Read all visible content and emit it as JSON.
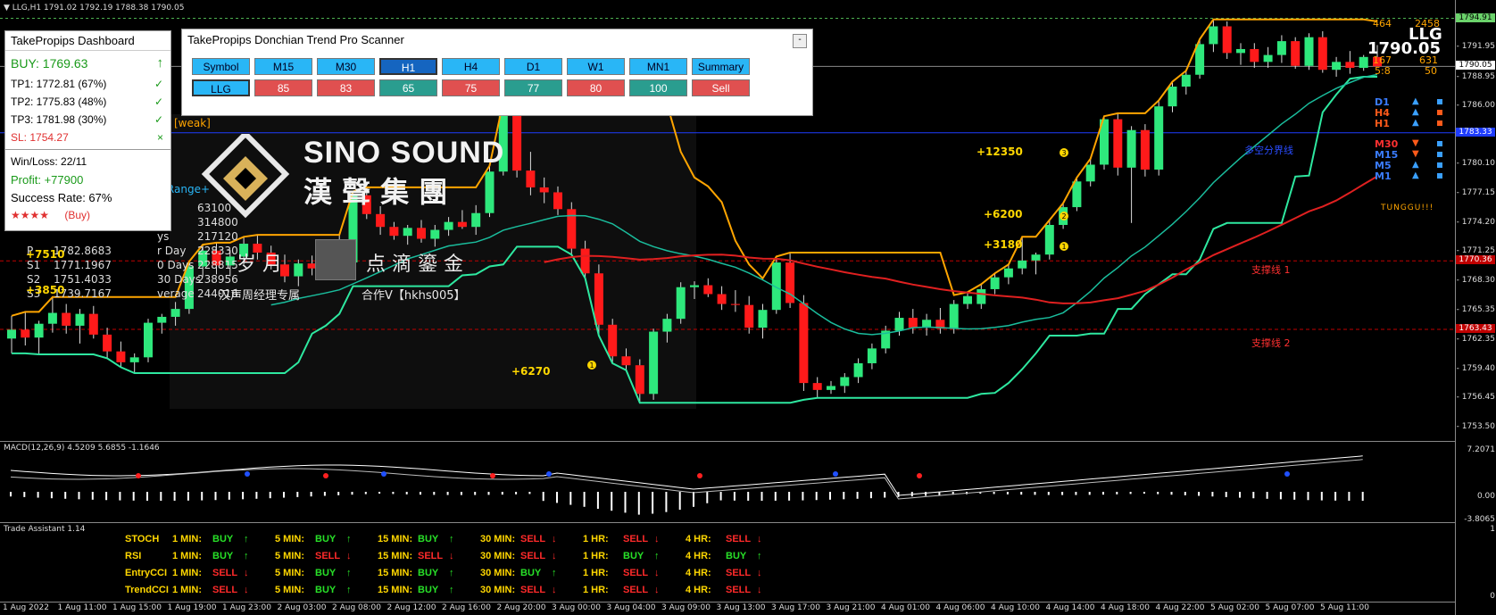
{
  "window": {
    "title": "▼ LLG,H1  1791.02 1792.19 1788.38 1790.05"
  },
  "watermark": {
    "brand": "SINO SOUND",
    "brand_cn": "漢 聲 集 團",
    "slogan_left": "岁 月",
    "slogan_right": "点 滴 鎏 金",
    "caption_left": "汉声周经理专属",
    "caption_right": "合作V【hkhs005】"
  },
  "dashboard": {
    "title": "TakePropips Dashboard",
    "signal": "BUY: 1769.63",
    "tp1": "TP1: 1772.81 (67%)",
    "tp2": "TP2: 1775.83 (48%)",
    "tp3": "TP3: 1781.98 (30%)",
    "sl_label": "SL:",
    "sl_value": "1754.27",
    "winloss": "Win/Loss: 22/11",
    "profit": "Profit: +77900",
    "success": "Success Rate: 67%",
    "stars": "★★★★",
    "stars_label": "(Buy)",
    "check": "✓",
    "cross": "×",
    "arrow_up": "↑"
  },
  "scanner": {
    "title": "TakePropips Donchian Trend Pro Scanner",
    "minimize": "-",
    "headers": [
      "Symbol",
      "M15",
      "M30",
      "H1",
      "H4",
      "D1",
      "W1",
      "MN1",
      "Summary"
    ],
    "values": [
      "LLG",
      "85",
      "83",
      "65",
      "75",
      "77",
      "80",
      "100",
      "Sell"
    ],
    "value_colors": [
      "hdr",
      "red",
      "red",
      "teal",
      "red",
      "teal",
      "red",
      "teal",
      "red"
    ]
  },
  "chart_labels": {
    "weak": "[weak]",
    "range": "y Range+",
    "hidden_rows": [
      {
        "k": "y",
        "v": "63100"
      },
      {
        "k": "ys",
        "v": "314800"
      },
      {
        "k": "ys",
        "v": "217120"
      },
      {
        "k": "r Day",
        "v": "228330"
      },
      {
        "k": "0 Days",
        "v": "228815"
      },
      {
        "k": "30 Days",
        "v": "238956"
      },
      {
        "k": "verage",
        "v": "244016"
      }
    ],
    "pivots": [
      {
        "k": "P",
        "v": "1782.8683"
      },
      {
        "k": "S1",
        "v": "1771.1967"
      },
      {
        "k": "S2",
        "v": "1751.4033"
      },
      {
        "k": "S3",
        "v": "1739.7167"
      }
    ],
    "plus_7510": "+7510",
    "plus_3850": "+3850",
    "plus_6270": "+6270",
    "plus_12350": "+12350",
    "plus_6200": "+6200",
    "plus_3180": "+3180",
    "n1": "1",
    "n2": "2",
    "n3": "3",
    "support_line": "支撑线 1",
    "support_line2": "支撑线 2",
    "divider_line": "多空分界线",
    "symbol_big": "LLG",
    "price_big": "1790.05",
    "top_nums": [
      "464",
      "2458"
    ],
    "mid_nums": [
      "167",
      "631"
    ],
    "ratio": [
      "5:8",
      "50"
    ],
    "brand_small": "TUNGGU!!!"
  },
  "timeframes": [
    {
      "label": "D1",
      "color": "#3a7cff",
      "arrow": "▲",
      "arrow_color": "#3aa0ff",
      "sq": "#3aa0ff"
    },
    {
      "label": "H4",
      "color": "#ff5a1a",
      "arrow": "▲",
      "arrow_color": "#3aa0ff",
      "sq": "#ff5a1a"
    },
    {
      "label": "H1",
      "color": "#ff5a1a",
      "arrow": "▲",
      "arrow_color": "#3aa0ff",
      "sq": "#ff5a1a"
    },
    {
      "label": "M30",
      "color": "#ff3030",
      "arrow": "▼",
      "arrow_color": "#ff5a1a",
      "sq": "#3aa0ff"
    },
    {
      "label": "M15",
      "color": "#3a7cff",
      "arrow": "▼",
      "arrow_color": "#ff5a1a",
      "sq": "#3aa0ff"
    },
    {
      "label": "M5",
      "color": "#3a7cff",
      "arrow": "▲",
      "arrow_color": "#3aa0ff",
      "sq": "#3aa0ff"
    },
    {
      "label": "M1",
      "color": "#3a7cff",
      "arrow": "▲",
      "arrow_color": "#3aa0ff",
      "sq": "#3aa0ff"
    }
  ],
  "price_scale": {
    "labels": [
      "1794.91",
      "1791.95",
      "1790.05",
      "1788.95",
      "1786.00",
      "1783.05",
      "1780.10",
      "1777.15",
      "1774.20",
      "1771.25",
      "1768.30",
      "1765.35",
      "1762.35",
      "1759.40",
      "1756.45",
      "1753.50"
    ],
    "boxes": [
      {
        "text": "1794.91",
        "bg": "#6bd36b",
        "fg": "#000"
      },
      {
        "text": "1790.05",
        "bg": "#ffffff",
        "fg": "#000"
      },
      {
        "text": "1783.33",
        "bg": "#1e3cff",
        "fg": "#fff"
      },
      {
        "text": "1770.36",
        "bg": "#c00000",
        "fg": "#fff"
      },
      {
        "text": "1763.43",
        "bg": "#c00000",
        "fg": "#fff"
      }
    ],
    "macd_labels": [
      "7.2071",
      "0.00",
      "-3.8065"
    ],
    "ta_labels": [
      "1",
      "0"
    ]
  },
  "macd": {
    "title": "MACD(12,26,9) 4.5209 5.6855 -1.1646"
  },
  "trade_assistant": {
    "title": "Trade Assistant 1.14",
    "rows": [
      {
        "name": "STOCH",
        "cells": [
          [
            "1 MIN:",
            "BUY"
          ],
          [
            "5 MIN:",
            "BUY"
          ],
          [
            "15 MIN:",
            "BUY"
          ],
          [
            "30 MIN:",
            "SELL"
          ],
          [
            "1 HR:",
            "SELL"
          ],
          [
            "4 HR:",
            "SELL"
          ]
        ]
      },
      {
        "name": "RSI",
        "cells": [
          [
            "1 MIN:",
            "BUY"
          ],
          [
            "5 MIN:",
            "SELL"
          ],
          [
            "15 MIN:",
            "SELL"
          ],
          [
            "30 MIN:",
            "SELL"
          ],
          [
            "1 HR:",
            "BUY"
          ],
          [
            "4 HR:",
            "BUY"
          ]
        ]
      },
      {
        "name": "EntryCCI",
        "cells": [
          [
            "1 MIN:",
            "SELL"
          ],
          [
            "5 MIN:",
            "BUY"
          ],
          [
            "15 MIN:",
            "BUY"
          ],
          [
            "30 MIN:",
            "BUY"
          ],
          [
            "1 HR:",
            "SELL"
          ],
          [
            "4 HR:",
            "SELL"
          ]
        ]
      },
      {
        "name": "TrendCCI",
        "cells": [
          [
            "1 MIN:",
            "SELL"
          ],
          [
            "5 MIN:",
            "BUY"
          ],
          [
            "15 MIN:",
            "BUY"
          ],
          [
            "30 MIN:",
            "SELL"
          ],
          [
            "1 HR:",
            "SELL"
          ],
          [
            "4 HR:",
            "SELL"
          ]
        ]
      }
    ]
  },
  "time_axis": [
    "1 Aug 2022",
    "1 Aug 11:00",
    "1 Aug 15:00",
    "1 Aug 19:00",
    "1 Aug 23:00",
    "2 Aug 03:00",
    "2 Aug 08:00",
    "2 Aug 12:00",
    "2 Aug 16:00",
    "2 Aug 20:00",
    "3 Aug 00:00",
    "3 Aug 04:00",
    "3 Aug 09:00",
    "3 Aug 13:00",
    "3 Aug 17:00",
    "3 Aug 21:00",
    "4 Aug 01:00",
    "4 Aug 06:00",
    "4 Aug 10:00",
    "4 Aug 14:00",
    "4 Aug 18:00",
    "4 Aug 22:00",
    "5 Aug 02:00",
    "5 Aug 07:00",
    "5 Aug 11:00"
  ],
  "candles": [
    [
      1762.5,
      1764.8,
      1761.0,
      1763.4
    ],
    [
      1763.4,
      1765.2,
      1761.8,
      1762.6
    ],
    [
      1762.6,
      1764.3,
      1760.9,
      1764.0
    ],
    [
      1764.0,
      1766.7,
      1763.1,
      1765.1
    ],
    [
      1765.1,
      1766.0,
      1763.0,
      1763.8
    ],
    [
      1763.8,
      1765.5,
      1762.0,
      1765.0
    ],
    [
      1765.0,
      1765.8,
      1762.5,
      1762.9
    ],
    [
      1762.9,
      1763.6,
      1760.5,
      1761.2
    ],
    [
      1761.2,
      1762.2,
      1759.6,
      1760.1
    ],
    [
      1760.1,
      1761.0,
      1759.0,
      1760.6
    ],
    [
      1760.6,
      1764.5,
      1760.1,
      1764.1
    ],
    [
      1764.1,
      1765.0,
      1763.0,
      1764.7
    ],
    [
      1764.7,
      1766.2,
      1763.8,
      1765.5
    ],
    [
      1765.5,
      1770.3,
      1765.0,
      1769.8
    ],
    [
      1769.8,
      1772.0,
      1768.8,
      1771.4
    ],
    [
      1771.4,
      1772.2,
      1769.0,
      1769.9
    ],
    [
      1769.9,
      1771.5,
      1768.8,
      1770.8
    ],
    [
      1770.8,
      1772.8,
      1770.0,
      1772.1
    ],
    [
      1772.1,
      1773.0,
      1770.5,
      1771.2
    ],
    [
      1771.2,
      1771.9,
      1769.5,
      1770.0
    ],
    [
      1770.0,
      1771.0,
      1768.2,
      1768.8
    ],
    [
      1768.8,
      1770.5,
      1767.8,
      1770.1
    ],
    [
      1770.1,
      1770.9,
      1768.9,
      1769.6
    ],
    [
      1769.6,
      1771.3,
      1769.0,
      1770.7
    ],
    [
      1770.7,
      1773.0,
      1769.8,
      1770.2
    ],
    [
      1770.2,
      1777.4,
      1770.0,
      1777.0
    ],
    [
      1777.0,
      1777.8,
      1774.6,
      1775.1
    ],
    [
      1775.1,
      1775.9,
      1773.0,
      1773.8
    ],
    [
      1773.8,
      1774.3,
      1772.5,
      1772.9
    ],
    [
      1772.9,
      1774.0,
      1772.0,
      1773.7
    ],
    [
      1773.7,
      1774.5,
      1772.2,
      1772.6
    ],
    [
      1772.6,
      1774.0,
      1771.8,
      1773.5
    ],
    [
      1773.5,
      1774.8,
      1772.9,
      1774.3
    ],
    [
      1774.3,
      1775.5,
      1773.6,
      1773.8
    ],
    [
      1773.8,
      1776.0,
      1773.0,
      1775.2
    ],
    [
      1775.2,
      1780.0,
      1774.8,
      1779.4
    ],
    [
      1779.4,
      1786.5,
      1779.0,
      1785.3
    ],
    [
      1785.3,
      1786.2,
      1778.8,
      1779.5
    ],
    [
      1779.5,
      1781.4,
      1777.0,
      1777.8
    ],
    [
      1777.8,
      1778.8,
      1776.2,
      1777.3
    ],
    [
      1777.3,
      1777.9,
      1775.0,
      1775.6
    ],
    [
      1775.6,
      1776.3,
      1771.0,
      1771.6
    ],
    [
      1771.6,
      1772.4,
      1768.6,
      1769.1
    ],
    [
      1769.1,
      1770.0,
      1762.8,
      1763.9
    ],
    [
      1763.9,
      1764.5,
      1760.0,
      1760.7
    ],
    [
      1760.7,
      1761.5,
      1759.3,
      1759.8
    ],
    [
      1759.8,
      1760.4,
      1756.0,
      1756.9
    ],
    [
      1756.9,
      1763.5,
      1756.3,
      1763.2
    ],
    [
      1763.2,
      1765.0,
      1762.1,
      1764.5
    ],
    [
      1764.5,
      1768.2,
      1764.0,
      1767.7
    ],
    [
      1767.7,
      1768.3,
      1766.5,
      1767.9
    ],
    [
      1767.9,
      1768.6,
      1766.7,
      1767.0
    ],
    [
      1767.0,
      1767.8,
      1765.4,
      1766.0
    ],
    [
      1766.0,
      1767.4,
      1765.2,
      1765.9
    ],
    [
      1765.9,
      1766.8,
      1763.0,
      1763.6
    ],
    [
      1763.6,
      1766.0,
      1762.5,
      1765.4
    ],
    [
      1765.4,
      1770.8,
      1765.0,
      1770.2
    ],
    [
      1770.2,
      1771.2,
      1765.6,
      1766.1
    ],
    [
      1766.1,
      1766.9,
      1757.2,
      1758.0
    ],
    [
      1758.0,
      1758.6,
      1756.5,
      1757.3
    ],
    [
      1757.3,
      1758.2,
      1756.9,
      1757.7
    ],
    [
      1757.7,
      1759.0,
      1757.0,
      1758.6
    ],
    [
      1758.6,
      1760.5,
      1758.0,
      1760.0
    ],
    [
      1760.0,
      1762.0,
      1759.4,
      1761.5
    ],
    [
      1761.5,
      1763.8,
      1761.0,
      1763.3
    ],
    [
      1763.3,
      1765.2,
      1762.8,
      1764.6
    ],
    [
      1764.6,
      1765.5,
      1763.0,
      1763.6
    ],
    [
      1763.6,
      1765.0,
      1762.8,
      1764.4
    ],
    [
      1764.4,
      1765.6,
      1763.0,
      1763.5
    ],
    [
      1763.5,
      1766.4,
      1763.0,
      1766.0
    ],
    [
      1766.0,
      1767.2,
      1765.5,
      1766.8
    ],
    [
      1766.0,
      1768.0,
      1765.5,
      1767.5
    ],
    [
      1767.5,
      1769.1,
      1767.0,
      1768.7
    ],
    [
      1768.7,
      1770.0,
      1768.0,
      1769.6
    ],
    [
      1769.6,
      1772.8,
      1769.0,
      1770.4
    ],
    [
      1770.4,
      1771.2,
      1769.0,
      1771.0
    ],
    [
      1771.0,
      1774.5,
      1770.5,
      1774.0
    ],
    [
      1774.0,
      1776.2,
      1773.6,
      1775.8
    ],
    [
      1775.8,
      1778.8,
      1775.4,
      1778.4
    ],
    [
      1778.4,
      1780.7,
      1777.9,
      1780.1
    ],
    [
      1780.1,
      1785.0,
      1779.6,
      1784.7
    ],
    [
      1784.7,
      1785.3,
      1779.0,
      1779.8
    ],
    [
      1779.8,
      1784.0,
      1774.2,
      1783.6
    ],
    [
      1783.6,
      1784.2,
      1778.9,
      1779.6
    ],
    [
      1779.6,
      1786.6,
      1779.0,
      1786.0
    ],
    [
      1786.0,
      1788.5,
      1785.4,
      1788.0
    ],
    [
      1788.0,
      1789.6,
      1787.2,
      1789.2
    ],
    [
      1789.2,
      1792.8,
      1788.8,
      1792.3
    ],
    [
      1792.3,
      1794.8,
      1791.5,
      1794.1
    ],
    [
      1794.1,
      1794.6,
      1790.8,
      1791.4
    ],
    [
      1791.4,
      1792.4,
      1790.2,
      1791.8
    ],
    [
      1791.8,
      1792.4,
      1789.9,
      1790.5
    ],
    [
      1790.5,
      1792.0,
      1789.9,
      1791.2
    ],
    [
      1791.2,
      1793.2,
      1790.4,
      1792.6
    ],
    [
      1792.6,
      1793.0,
      1789.8,
      1790.1
    ],
    [
      1790.1,
      1793.4,
      1789.7,
      1793.0
    ],
    [
      1793.0,
      1793.6,
      1789.4,
      1789.7
    ],
    [
      1789.7,
      1791.0,
      1789.0,
      1790.5
    ],
    [
      1790.5,
      1791.6,
      1789.3,
      1789.9
    ],
    [
      1789.9,
      1791.2,
      1789.6,
      1791.0
    ],
    [
      1791.0,
      1792.2,
      1790.3,
      1790.05
    ]
  ]
}
